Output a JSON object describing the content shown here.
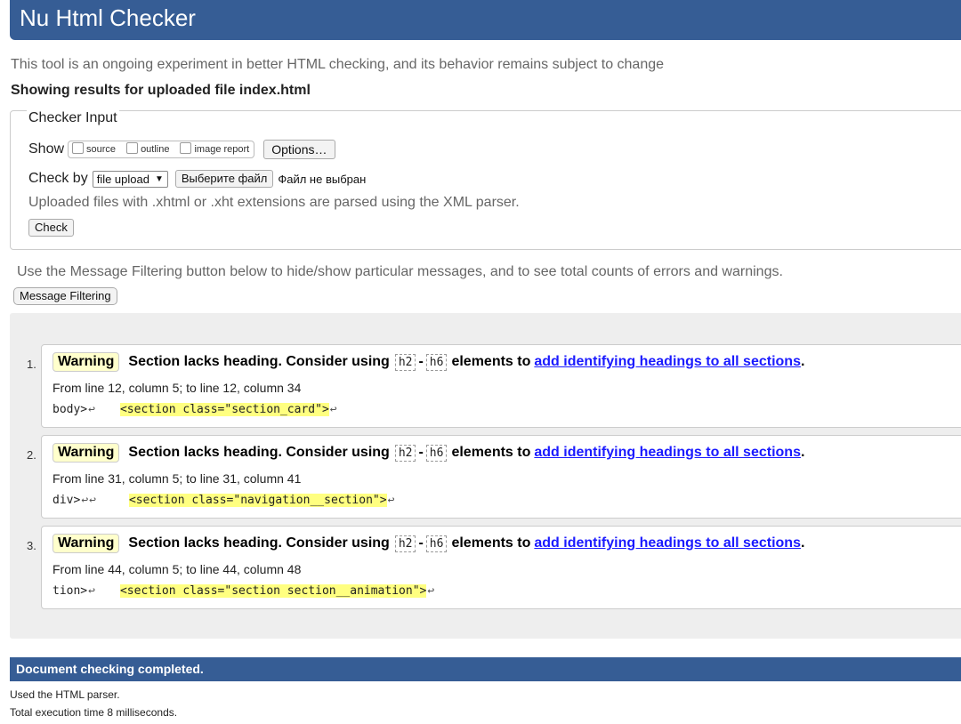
{
  "header": {
    "title": "Nu Html Checker"
  },
  "tagline": "This tool is an ongoing experiment in better HTML checking, and its behavior remains subject to change",
  "showing": "Showing results for uploaded file index.html",
  "checker_input": {
    "legend": "Checker Input",
    "show_label": "Show",
    "options": [
      "source",
      "outline",
      "image report"
    ],
    "options_button": "Options…",
    "check_by_label": "Check by",
    "check_by_value": "file upload",
    "choose_file_button": "Выберите файл",
    "file_status": "Файл не выбран",
    "xml_note": "Uploaded files with .xhtml or .xht extensions are parsed using the XML parser.",
    "check_button": "Check"
  },
  "filter": {
    "note": "Use the Message Filtering button below to hide/show particular messages, and to see total counts of errors and warnings.",
    "button": "Message Filtering"
  },
  "messages": [
    {
      "number": "1.",
      "type": "Warning",
      "text": "Section lacks heading. Consider using",
      "code_a": "h2",
      "dash": "-",
      "code_b": "h6",
      "text2": "elements to",
      "link": "add identifying headings to all sections",
      "period": ".",
      "location": "From line 12, column 5; to line 12, column 34",
      "extract_pre": "body>",
      "extract_hl": "<section class=\"section_card\">"
    },
    {
      "number": "2.",
      "type": "Warning",
      "text": "Section lacks heading. Consider using",
      "code_a": "h2",
      "dash": "-",
      "code_b": "h6",
      "text2": "elements to",
      "link": "add identifying headings to all sections",
      "period": ".",
      "location": "From line 31, column 5; to line 31, column 41",
      "extract_pre": "div>",
      "extract_hl": "<section class=\"navigation__section\">"
    },
    {
      "number": "3.",
      "type": "Warning",
      "text": "Section lacks heading. Consider using",
      "code_a": "h2",
      "dash": "-",
      "code_b": "h6",
      "text2": "elements to",
      "link": "add identifying headings to all sections",
      "period": ".",
      "location": "From line 44, column 5; to line 44, column 48",
      "extract_pre": "tion>",
      "extract_hl": "<section class=\"section section__animation\">"
    }
  ],
  "return_glyph": "↩",
  "footer": {
    "status": "Document checking completed.",
    "parser": "Used the HTML parser.",
    "time": "Total execution time 8 milliseconds."
  },
  "colors": {
    "brand": "#365d95",
    "warning_bg": "#ffffcc",
    "highlight": "#ffff80",
    "link": "#1a1aff"
  }
}
